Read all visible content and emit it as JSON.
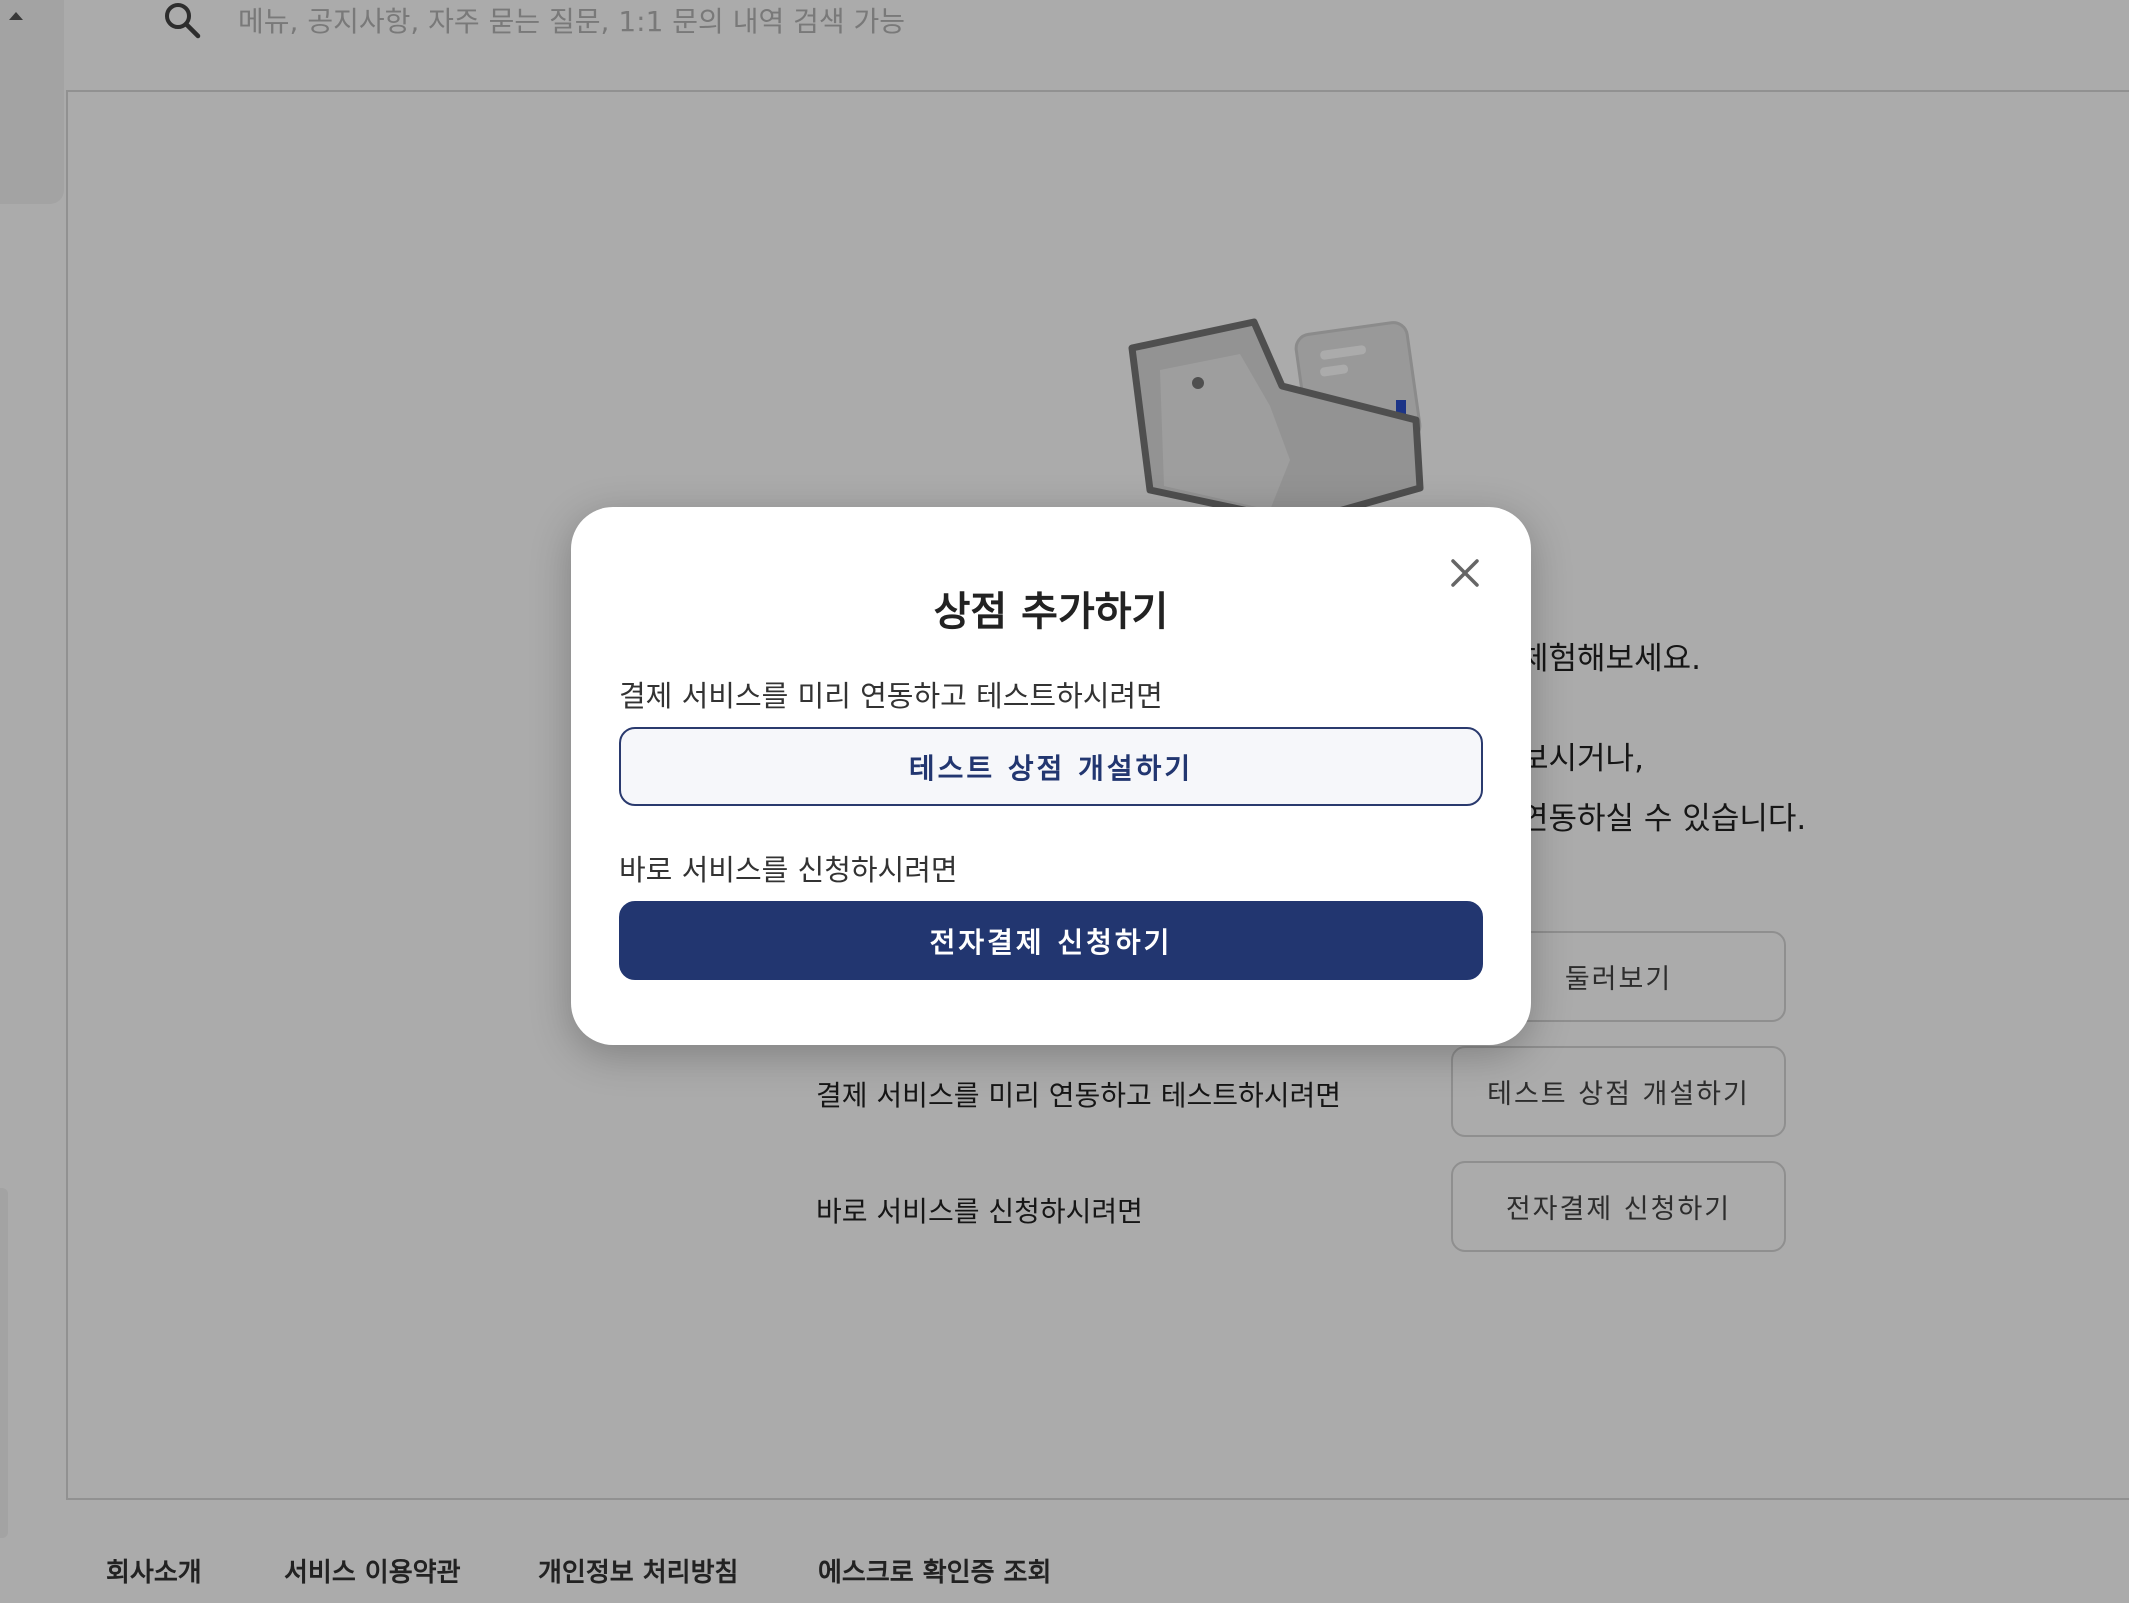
{
  "header": {
    "search_placeholder": "메뉴, 공지사항, 자주 묻는 질문, 1:1 문의 내역 검색 가능"
  },
  "main": {
    "text_line_1": "체험해보세요.",
    "text_line_2": "보시거나,",
    "text_line_3": "연동하실 수 있습니다.",
    "test_label": "결제 서비스를 미리 연동하고 테스트하시려면",
    "apply_label": "바로 서비스를 신청하시려면",
    "browse_button": "둘러보기",
    "test_button": "테스트 상점 개설하기",
    "apply_button": "전자결제 신청하기"
  },
  "footer": {
    "links": [
      "회사소개",
      "서비스 이용약관",
      "개인정보 처리방침",
      "에스크로 확인증 조회"
    ]
  },
  "modal": {
    "title": "상점 추가하기",
    "test_desc": "결제 서비스를 미리 연동하고 테스트하시려면",
    "test_button": "테스트 상점 개설하기",
    "apply_desc": "바로 서비스를 신청하시려면",
    "apply_button": "전자결제 신청하기"
  },
  "colors": {
    "primary": "#223670",
    "overlay": "rgba(0,0,0,0.33)"
  },
  "icons": [
    "search-icon",
    "close-icon",
    "wallet-illustration",
    "caret-up-icon"
  ]
}
